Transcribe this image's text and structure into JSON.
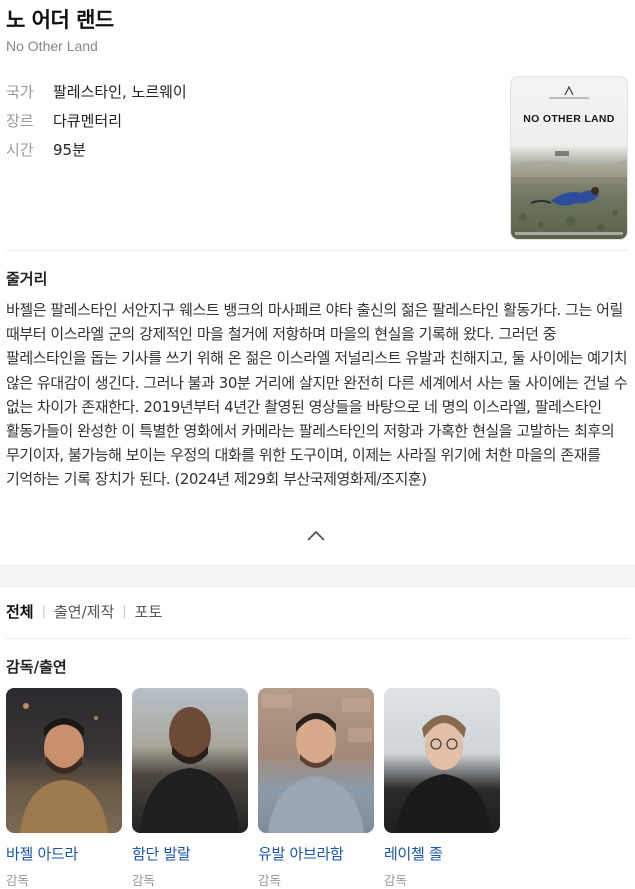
{
  "movie": {
    "title_ko": "노 어더 랜드",
    "title_en": "No Other Land"
  },
  "info": [
    {
      "key": "국가",
      "value": "팔레스타인, 노르웨이"
    },
    {
      "key": "장르",
      "value": "다큐멘터리"
    },
    {
      "key": "시간",
      "value": "95분"
    }
  ],
  "poster": {
    "title": "NO OTHER LAND"
  },
  "synopsis": {
    "heading": "줄거리",
    "text": "바젤은 팔레스타인 서안지구 웨스트 뱅크의 마사페르 야타 출신의 젊은 팔레스타인 활동가다. 그는 어릴 때부터 이스라엘 군의 강제적인 마을 철거에 저항하며 마을의 현실을 기록해 왔다. 그러던 중 팔레스타인을 돕는 기사를 쓰기 위해 온 젊은 이스라엘 저널리스트 유발과 친해지고, 둘 사이에는 예기치 않은 유대감이 생긴다. 그러나 불과 30분 거리에 살지만 완전히 다른 세계에서 사는 둘 사이에는 건널 수 없는 차이가 존재한다. 2019년부터 4년간 촬영된 영상들을 바탕으로 네 명의 이스라엘, 팔레스타인 활동가들이 완성한 이 특별한 영화에서 카메라는 팔레스타인의 저항과 가혹한 현실을 고발하는 최후의 무기이자, 불가능해 보이는 우정의 대화를 위한 도구이며, 이제는 사라질 위기에 처한 마을의 존재를 기억하는 기록 장치가 된다. (2024년 제29회 부산국제영화제/조지훈)"
  },
  "tabs": [
    "전체",
    "출연/제작",
    "포토"
  ],
  "cast_section": {
    "heading": "감독/출연",
    "people": [
      {
        "name": "바젤 아드라",
        "role": "감독"
      },
      {
        "name": "함단 발랄",
        "role": "감독"
      },
      {
        "name": "유발 아브라함",
        "role": "감독"
      },
      {
        "name": "레이첼 졸",
        "role": "감독"
      }
    ]
  },
  "icons": {
    "collapse": "chevron-up-icon"
  }
}
